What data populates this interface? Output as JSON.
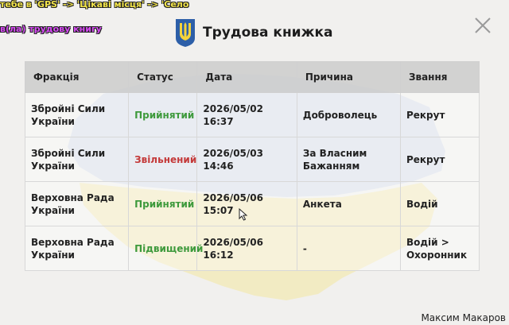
{
  "overlay": {
    "line1": "тебе в 'GPS' -> 'Цікаві місця' -> 'Село",
    "line2": "в(ла) трудову книгу"
  },
  "header": {
    "title": "Трудова книжка",
    "icon": "trident-coat-of-arms-icon"
  },
  "close_icon": "close-icon",
  "table": {
    "columns": [
      "Фракція",
      "Статус",
      "Дата",
      "Причина",
      "Звання"
    ],
    "rows": [
      {
        "faction": "Збройні Сили України",
        "status": "Прийнятий",
        "status_kind": "accepted",
        "date": "2026/05/02 16:37",
        "reason": "Доброволець",
        "rank": "Рекрут"
      },
      {
        "faction": "Збройні Сили України",
        "status": "Звільнений",
        "status_kind": "fired",
        "date": "2026/05/03 14:46",
        "reason": "За Власним Бажанням",
        "rank": "Рекрут"
      },
      {
        "faction": "Верховна Рада України",
        "status": "Прийнятий",
        "status_kind": "accepted",
        "date": "2026/05/06 15:07",
        "reason": "Анкета",
        "rank": "Водій"
      },
      {
        "faction": "Верховна Рада України",
        "status": "Підвищений",
        "status_kind": "accepted",
        "date": "2026/05/06 16:12",
        "reason": "-",
        "rank": "Водій > Охоронник"
      }
    ]
  },
  "footer": {
    "player_name": "Максим Макаров"
  },
  "colors": {
    "accepted": "#3e9a3c",
    "fired": "#c43a3a",
    "flag_blue": "#3b6fb6",
    "flag_yellow": "#f5d33b"
  }
}
